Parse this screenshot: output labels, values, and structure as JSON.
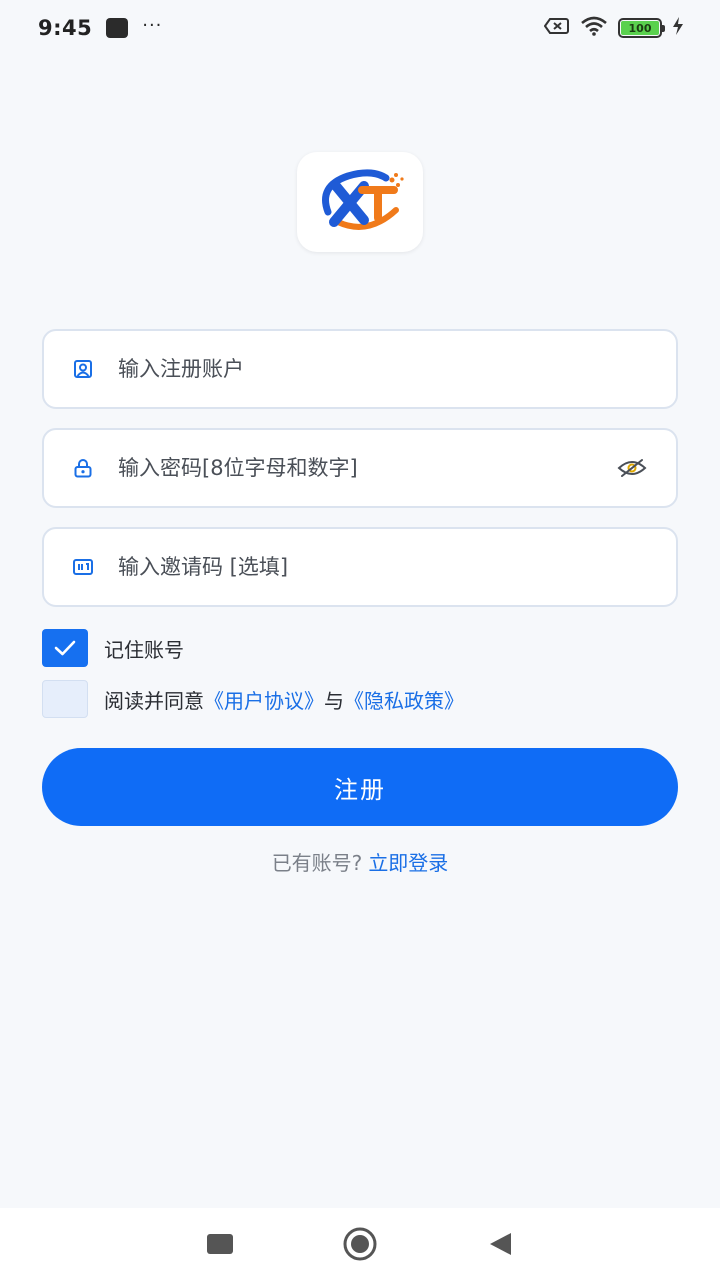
{
  "status_bar": {
    "time": "9:45",
    "battery": "100",
    "icons": [
      "notification-square-icon",
      "more-dots-icon",
      "sim-off-icon",
      "wifi-icon",
      "battery-icon",
      "charging-icon"
    ]
  },
  "logo": {
    "icon": "xt-logo-icon",
    "colors": {
      "blue": "#1f5bd6",
      "orange": "#f07a1a"
    }
  },
  "form": {
    "account": {
      "placeholder": "输入注册账户",
      "value": "",
      "icon": "portrait-icon"
    },
    "password": {
      "placeholder": "输入密码[8位字母和数字]",
      "value": "",
      "icon": "lock-icon",
      "toggle_icon": "eye-hidden-icon"
    },
    "invite": {
      "placeholder": "输入邀请码 [选填]",
      "value": "",
      "icon": "invite-code-icon"
    }
  },
  "remember": {
    "label": "记住账号",
    "checked": true
  },
  "agreement": {
    "prefix": "阅读并同意",
    "terms": "《用户协议》",
    "and": "与",
    "privacy": "《隐私政策》",
    "checked": false
  },
  "register_button": {
    "label": "注册"
  },
  "login": {
    "question": "已有账号?",
    "link": "立即登录"
  },
  "nav": {
    "icons": [
      "recents-square-icon",
      "home-circle-icon",
      "back-triangle-icon"
    ]
  },
  "colors": {
    "primary": "#0f6cf6",
    "link": "#1a6fe6",
    "background": "#f6f8fb"
  }
}
